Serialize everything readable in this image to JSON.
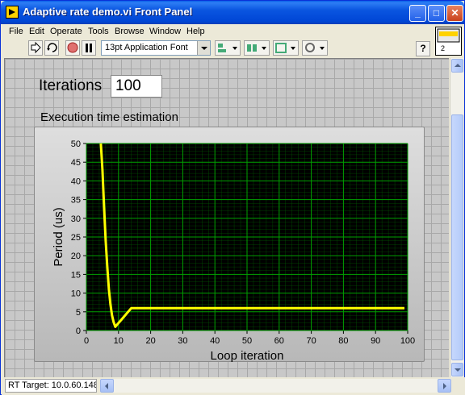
{
  "window": {
    "title": "Adaptive rate demo.vi Front Panel"
  },
  "menu": [
    "File",
    "Edit",
    "Operate",
    "Tools",
    "Browse",
    "Window",
    "Help"
  ],
  "toolbar": {
    "font": "13pt Application Font",
    "help": "?",
    "connector_number": "2"
  },
  "controls": {
    "iterations_label": "Iterations",
    "iterations_value": "100"
  },
  "chart_title": "Execution time estimation",
  "status": {
    "target": "RT Target: 10.0.60.148"
  },
  "colors": {
    "plot_bg": "#000000",
    "grid": "#006d00",
    "trace": "#ffff00",
    "panel_bg": "#c8c8c8"
  },
  "chart_data": {
    "type": "line",
    "xlabel": "Loop iteration",
    "ylabel": "Period (us)",
    "xlim": [
      0,
      100
    ],
    "ylim": [
      0,
      50
    ],
    "xticks": [
      0,
      10,
      20,
      30,
      40,
      50,
      60,
      70,
      80,
      90,
      100
    ],
    "yticks": [
      0,
      5,
      10,
      15,
      20,
      25,
      30,
      35,
      40,
      45,
      50
    ],
    "grid": true,
    "series": [
      {
        "x": [
          4.5,
          5,
          5.5,
          6,
          6.5,
          7,
          7.5,
          8,
          8.5,
          9,
          10,
          11,
          12,
          13,
          14,
          15,
          20,
          30,
          40,
          50,
          60,
          70,
          80,
          90,
          99
        ],
        "y": [
          50,
          43,
          33,
          24,
          17,
          11,
          7,
          4,
          2.2,
          1,
          2,
          3,
          4,
          5,
          6,
          6,
          6,
          6,
          6,
          6,
          6,
          6,
          6,
          6,
          6
        ]
      }
    ]
  }
}
